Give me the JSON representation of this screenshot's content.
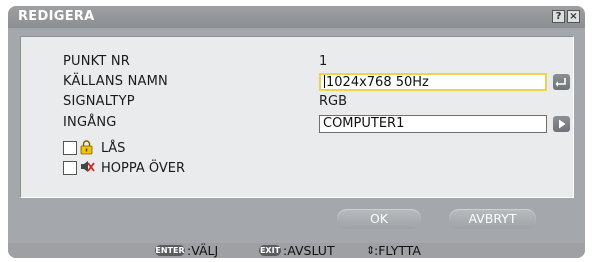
{
  "window": {
    "title": "REDIGERA",
    "help_glyph": "?",
    "close_glyph": "×"
  },
  "form": {
    "rows": [
      {
        "label": "PUNKT NR",
        "value": "1"
      },
      {
        "label": "KÄLLANS NAMN",
        "value": "1024x768 50Hz"
      },
      {
        "label": "SIGNALTYP",
        "value": "RGB"
      },
      {
        "label": "INGÅNG",
        "value": "COMPUTER1"
      }
    ],
    "checkboxes": [
      {
        "label": "LÅS",
        "icon": "lock-icon",
        "checked": false
      },
      {
        "label": "HOPPA ÖVER",
        "icon": "skip-icon",
        "checked": false
      }
    ]
  },
  "buttons": {
    "ok": "OK",
    "cancel": "AVBRYT"
  },
  "footer": {
    "enter_key": "ENTER",
    "enter_text": ":VÄLJ",
    "exit_key": "EXIT",
    "exit_text": ":AVSLUT",
    "move_glyph": "⇕",
    "move_text": ":FLYTTA"
  },
  "colors": {
    "dialog_bg": "#a4a7ab",
    "panel_bg": "#e9ebec",
    "active_field_border": "#f2d24a",
    "lock_yellow": "#f5c400",
    "skip_red": "#d0261e"
  }
}
